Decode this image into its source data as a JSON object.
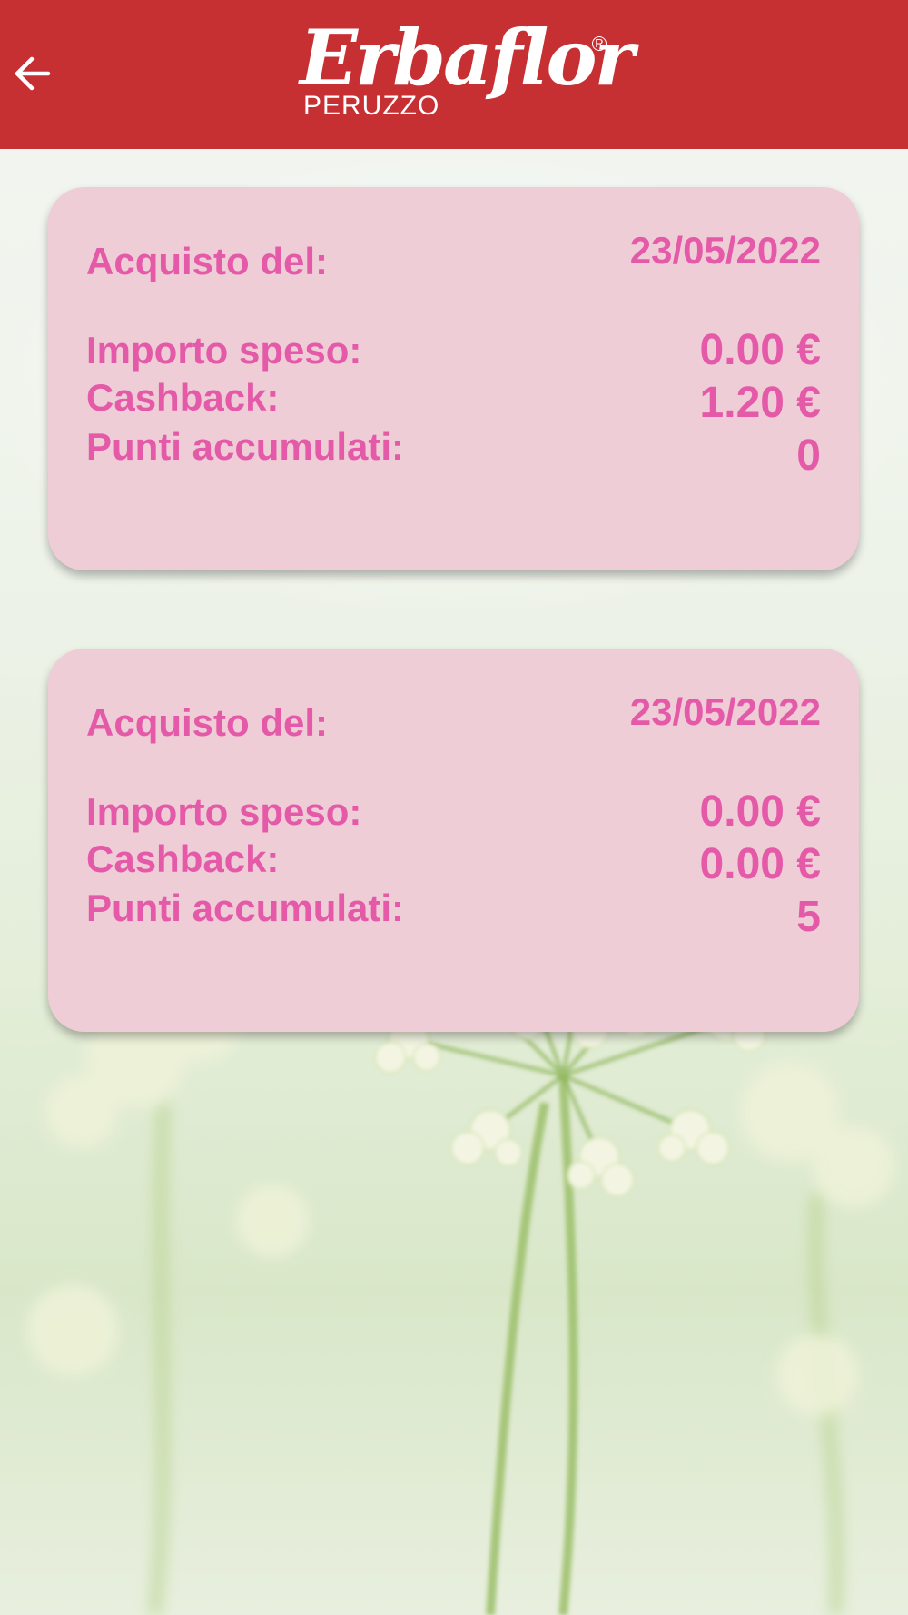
{
  "header": {
    "logo_script": "Erbaflor",
    "logo_sub": "PERUZZO",
    "logo_reg": "R",
    "back_icon": "arrow-left-icon"
  },
  "purchases": [
    {
      "date_label": "Acquisto del:",
      "date": "23/05/2022",
      "spent_label": "Importo speso:",
      "spent": "0.00 €",
      "cashback_label": "Cashback:",
      "cashback": "1.20 €",
      "points_label": "Punti accumulati:",
      "points": "0"
    },
    {
      "date_label": "Acquisto del:",
      "date": "23/05/2022",
      "spent_label": "Importo speso:",
      "spent": "0.00 €",
      "cashback_label": "Cashback:",
      "cashback": "0.00 €",
      "points_label": "Punti accumulati:",
      "points": "5"
    }
  ],
  "colors": {
    "header_bg": "#c73033",
    "card_bg": "#efcdd6",
    "card_text": "#e45aa8"
  }
}
